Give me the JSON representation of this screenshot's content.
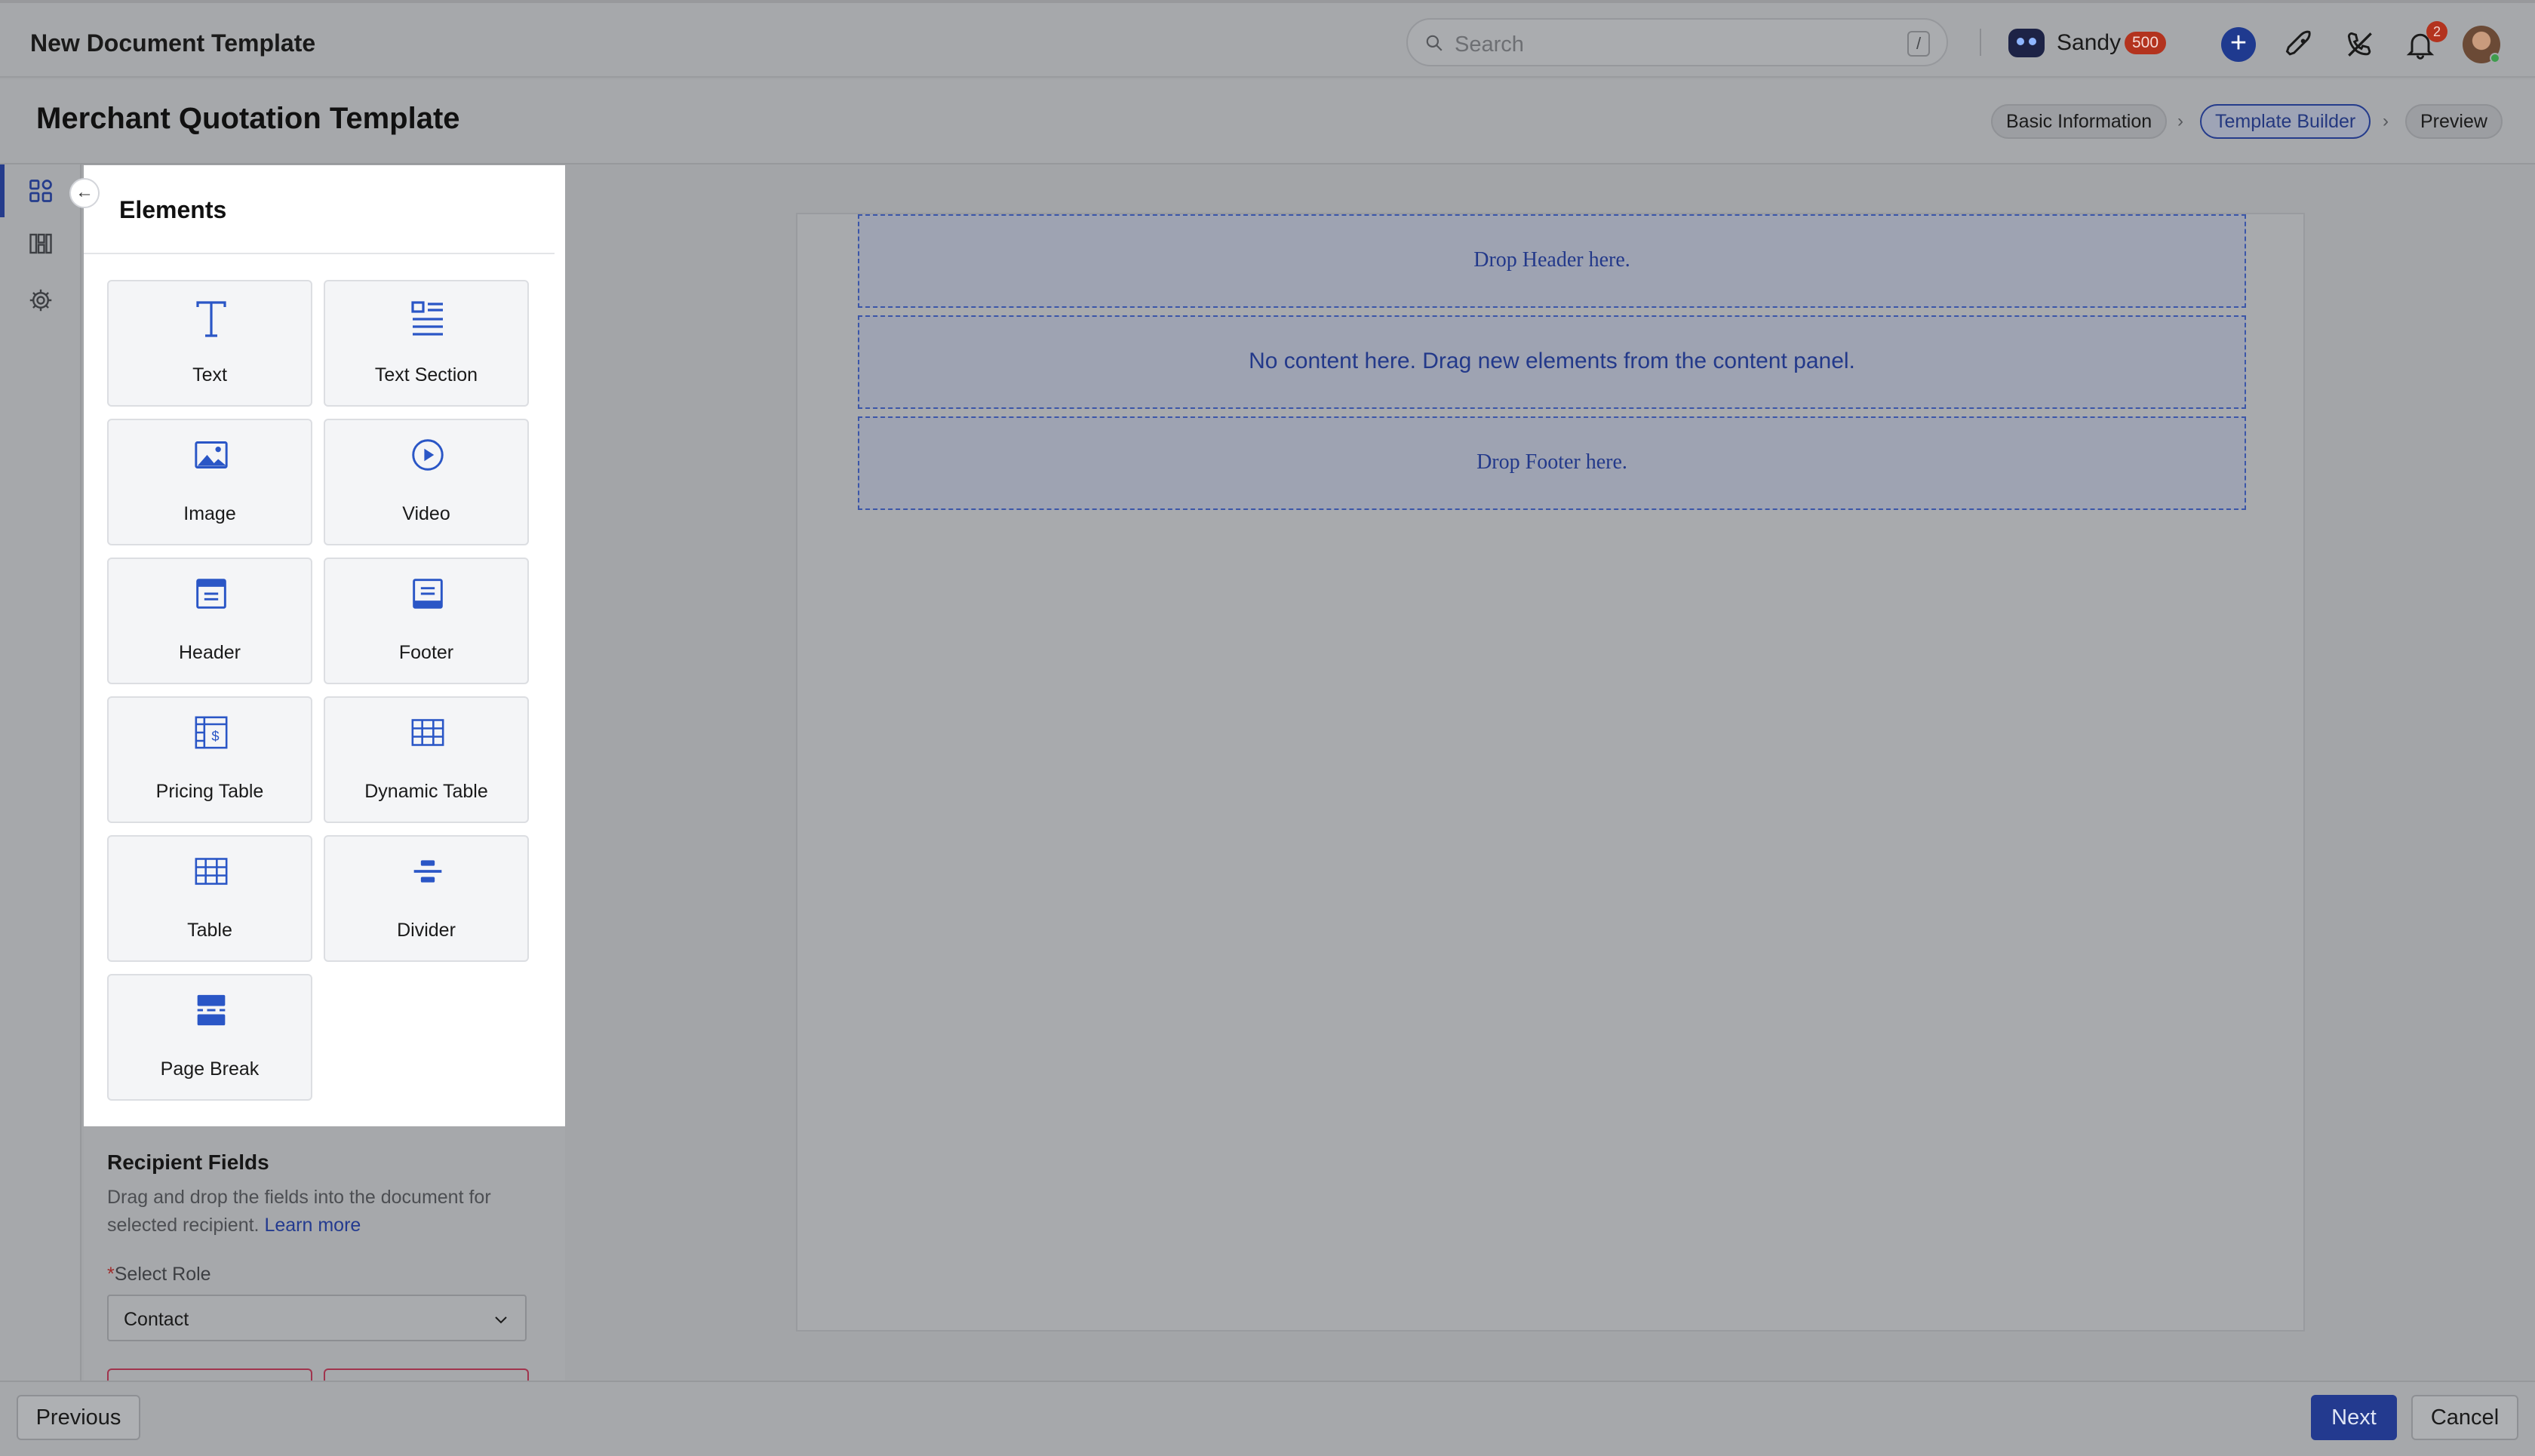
{
  "app": {
    "title": "New Document Template"
  },
  "search": {
    "placeholder": "Search",
    "shortcut": "/"
  },
  "user": {
    "name": "Sandy",
    "credits": "500",
    "notifications": "2"
  },
  "page": {
    "title": "Merchant Quotation Template"
  },
  "steps": [
    {
      "label": "Basic Information",
      "active": false
    },
    {
      "label": "Template Builder",
      "active": true
    },
    {
      "label": "Preview",
      "active": false
    }
  ],
  "rail": [
    {
      "icon": "elements-grid-icon",
      "active": true
    },
    {
      "icon": "layout-blocks-icon",
      "active": false
    },
    {
      "icon": "settings-gear-icon",
      "active": false
    }
  ],
  "elements_panel": {
    "title": "Elements",
    "collapse_icon": "arrow-left-icon",
    "items": [
      {
        "label": "Text",
        "icon": "text-icon"
      },
      {
        "label": "Text Section",
        "icon": "text-section-icon"
      },
      {
        "label": "Image",
        "icon": "image-icon"
      },
      {
        "label": "Video",
        "icon": "video-play-icon"
      },
      {
        "label": "Header",
        "icon": "header-icon"
      },
      {
        "label": "Footer",
        "icon": "footer-icon"
      },
      {
        "label": "Pricing Table",
        "icon": "pricing-table-icon"
      },
      {
        "label": "Dynamic Table",
        "icon": "dynamic-table-icon"
      },
      {
        "label": "Table",
        "icon": "table-icon"
      },
      {
        "label": "Divider",
        "icon": "divider-icon"
      },
      {
        "label": "Page Break",
        "icon": "page-break-icon"
      }
    ]
  },
  "recipient_fields": {
    "title": "Recipient Fields",
    "description": "Drag and drop the fields into the document for selected recipient.",
    "link": "Learn more",
    "role_label": "Select Role",
    "required_mark": "*",
    "role_value": "Contact"
  },
  "canvas": {
    "header_drop": "Drop Header here.",
    "content_empty": "No content here. Drag new elements from the content panel.",
    "footer_drop": "Drop Footer here."
  },
  "footer": {
    "previous": "Previous",
    "next": "Next",
    "cancel": "Cancel"
  },
  "colors": {
    "primary": "#233a8f",
    "badge": "#b3331e",
    "icon_blue": "#2a56c6"
  }
}
